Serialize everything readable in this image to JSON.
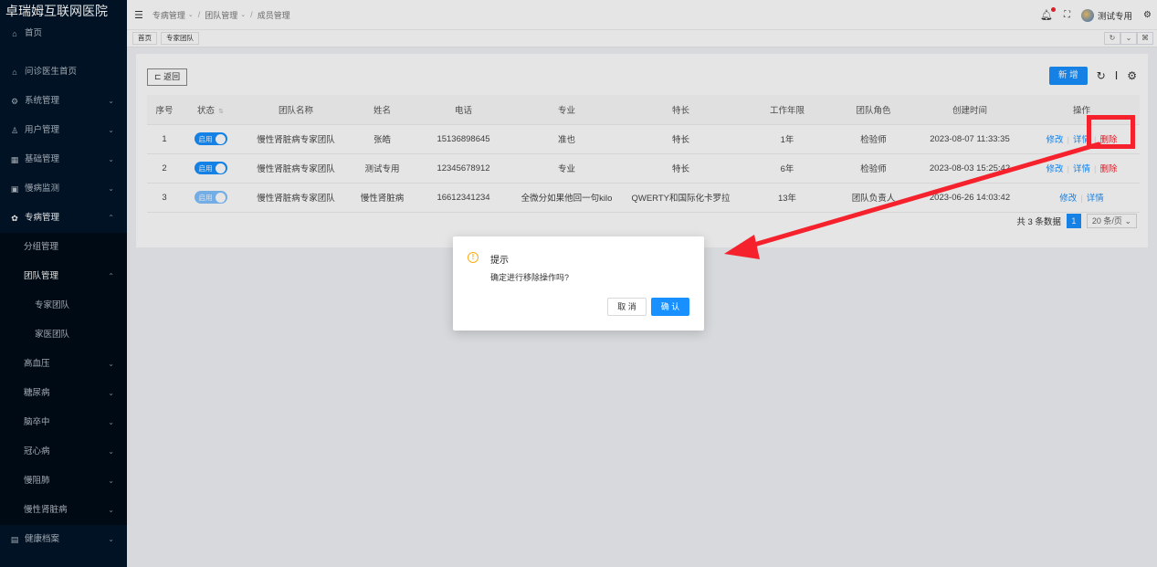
{
  "app": {
    "title": "卓瑞姆互联网医院"
  },
  "sidebar": {
    "items": [
      {
        "label": "首页",
        "icon": "home-icon",
        "chevron": false
      },
      {
        "label": "问诊医生首页",
        "icon": "home-icon",
        "chevron": false
      },
      {
        "label": "系统管理",
        "icon": "gear-icon",
        "chevron": true
      },
      {
        "label": "用户管理",
        "icon": "user-icon",
        "chevron": true
      },
      {
        "label": "基础管理",
        "icon": "grid-icon",
        "chevron": true
      },
      {
        "label": "慢病监测",
        "icon": "monitor-icon",
        "chevron": true
      },
      {
        "label": "专病管理",
        "icon": "flower-icon",
        "chevron": true
      }
    ],
    "sub_items": {
      "group": "分组管理",
      "team": "团队管理",
      "expert_team": "专家团队",
      "family_team": "家医团队",
      "hypertension": "高血压",
      "diabetes": "糖尿病",
      "stroke": "脑卒中",
      "coronary": "冠心病",
      "copd": "慢阻肺",
      "ckd": "慢性肾脏病"
    },
    "health_archive": "健康档案"
  },
  "header": {
    "breadcrumb": [
      "专病管理",
      "团队管理",
      "成员管理"
    ],
    "username": "测试专用"
  },
  "tags": [
    "首页",
    "专家团队"
  ],
  "toolbar": {
    "back_label": "返回",
    "new_label": "新 增"
  },
  "table": {
    "headers": [
      "序号",
      "状态",
      "团队名称",
      "姓名",
      "电话",
      "专业",
      "特长",
      "工作年限",
      "团队角色",
      "创建时间",
      "操作"
    ],
    "rows": [
      {
        "no": "1",
        "status": "启用",
        "team": "慢性肾脏病专家团队",
        "name": "张皓",
        "phone": "15136898645",
        "major": "准也",
        "specialty": "特长",
        "years": "1年",
        "role": "检验师",
        "created": "2023-08-07 11:33:35",
        "ops": [
          "修改",
          "详情",
          "删除"
        ]
      },
      {
        "no": "2",
        "status": "启用",
        "team": "慢性肾脏病专家团队",
        "name": "测试专用",
        "phone": "12345678912",
        "major": "专业",
        "specialty": "特长",
        "years": "6年",
        "role": "检验师",
        "created": "2023-08-03 15:25:42",
        "ops": [
          "修改",
          "详情",
          "删除"
        ]
      },
      {
        "no": "3",
        "status": "启用",
        "team": "慢性肾脏病专家团队",
        "name": "慢性肾脏病",
        "phone": "16612341234",
        "major": "全微分如果他回一句kilo",
        "specialty": "QWERTY和国际化卡罗拉",
        "years": "13年",
        "role": "团队负责人",
        "created": "2023-06-26 14:03:42",
        "ops": [
          "修改",
          "详情"
        ]
      }
    ]
  },
  "pager": {
    "total": "共 3 条数据",
    "page": "1",
    "size": "20 条/页"
  },
  "dialog": {
    "title": "提示",
    "message": "确定进行移除操作吗?",
    "cancel": "取 消",
    "ok": "确 认"
  },
  "colors": {
    "primary": "#1890ff",
    "danger": "#f5222d",
    "sidebar_bg": "#001529",
    "warning": "#faad14"
  }
}
